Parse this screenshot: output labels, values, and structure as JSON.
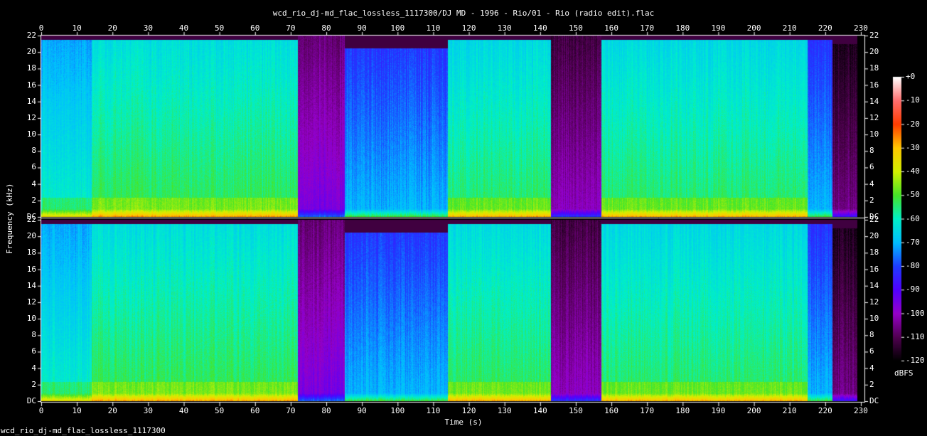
{
  "title": "wcd_rio_dj-md_flac_lossless_1117300/DJ MD - 1996 - Rio/01 - Rio (radio edit).flac",
  "footer": "wcd_rio_dj-md_flac_lossless_1117300",
  "chart_data": {
    "type": "heatmap",
    "xlabel": "Time (s)",
    "ylabel": "Frequency (kHz)",
    "xlim": [
      0,
      231
    ],
    "ylim": [
      0,
      22
    ],
    "x_ticks": [
      "0",
      "10",
      "20",
      "30",
      "40",
      "50",
      "60",
      "70",
      "80",
      "90",
      "100",
      "110",
      "120",
      "130",
      "140",
      "150",
      "160",
      "170",
      "180",
      "190",
      "200",
      "210",
      "220",
      "230"
    ],
    "y_ticks": [
      "DC",
      "2",
      "4",
      "6",
      "8",
      "10",
      "12",
      "14",
      "16",
      "18",
      "20",
      "22"
    ],
    "channels": 2,
    "colorbar": {
      "label": "dBFS",
      "ticks": [
        "+0",
        "-10",
        "-20",
        "-30",
        "-40",
        "-50",
        "-60",
        "-70",
        "-80",
        "-90",
        "-100",
        "-110",
        "-120"
      ],
      "range": [
        -120,
        0
      ]
    },
    "segments": [
      {
        "start": 0,
        "end": 14,
        "level_dB": -60,
        "cutoff_kHz": 21.5
      },
      {
        "start": 14,
        "end": 72,
        "level_dB": -52,
        "cutoff_kHz": 21.5
      },
      {
        "start": 72,
        "end": 85,
        "level_dB": -95,
        "cutoff_kHz": 22
      },
      {
        "start": 85,
        "end": 114,
        "level_dB": -70,
        "cutoff_kHz": 20.5
      },
      {
        "start": 114,
        "end": 143,
        "level_dB": -53,
        "cutoff_kHz": 21.5
      },
      {
        "start": 143,
        "end": 157,
        "level_dB": -100,
        "cutoff_kHz": 22
      },
      {
        "start": 157,
        "end": 215,
        "level_dB": -53,
        "cutoff_kHz": 21.5
      },
      {
        "start": 215,
        "end": 222,
        "level_dB": -70,
        "cutoff_kHz": 21.5
      },
      {
        "start": 222,
        "end": 229,
        "level_dB": -105,
        "cutoff_kHz": 21
      }
    ]
  }
}
